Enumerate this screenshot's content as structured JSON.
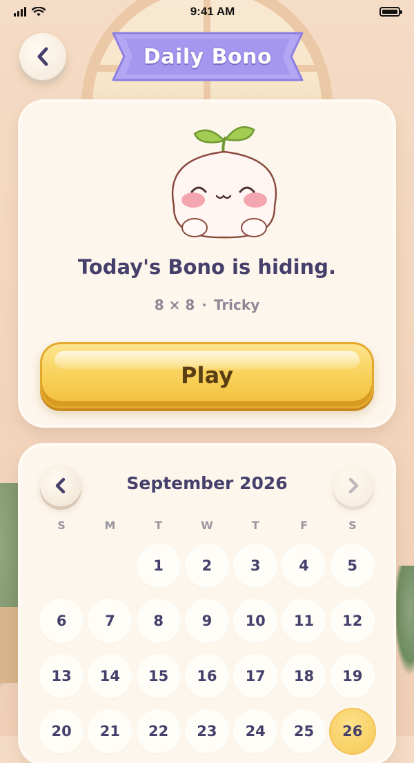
{
  "status_bar": {
    "time": "9:41 AM"
  },
  "header": {
    "title": "Daily Bono",
    "back_icon": "chevron-left-icon"
  },
  "today": {
    "message": "Today's Bono is hiding.",
    "grid_size": "8 × 8",
    "separator": "·",
    "difficulty": "Tricky",
    "play_label": "Play"
  },
  "calendar": {
    "month": "September 2026",
    "weekdays": [
      "S",
      "M",
      "T",
      "W",
      "T",
      "F",
      "S"
    ],
    "leading_blanks": 2,
    "visible_days": [
      1,
      2,
      3,
      4,
      5,
      6,
      7,
      8,
      9,
      10,
      11,
      12,
      13,
      14,
      15,
      16,
      17,
      18,
      19,
      20,
      21,
      22,
      23,
      24,
      25,
      26
    ],
    "selected_day": 26
  },
  "colors": {
    "accent_purple": "#a89af0",
    "play_yellow": "#f9d35e",
    "text_dark": "#45406b",
    "background": "#f5dcc6"
  }
}
